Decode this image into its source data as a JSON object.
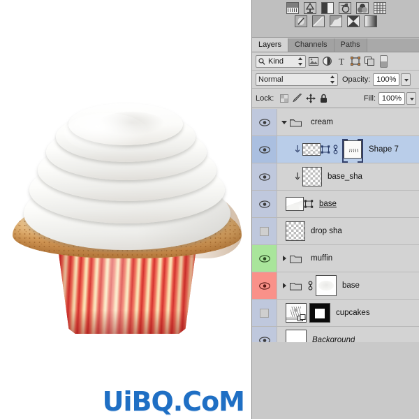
{
  "app": {
    "document_title": "cupcakes",
    "watermark": "UiBQ.CoM",
    "watermark_color": "#1f6fc4"
  },
  "canvas": {
    "name": "cupcake-illustration",
    "description": "Cupcake with white swirled cream frosting, golden baked muffin top and red striped paper liner",
    "background_color": "#ffffff",
    "colors": {
      "cream": "#ffffff",
      "cream_shadow": "#dedbd6",
      "muffin_light": "#f6dfb9",
      "muffin_dark": "#bd7f43",
      "liner_red": "#e8564a",
      "liner_deep_red": "#cf2f2c",
      "liner_cream": "#f9d7a6"
    }
  },
  "adjustments": {
    "name": "adjustments-panel",
    "row1": [
      {
        "icon": "brightness-contrast-icon",
        "label": "Brightness/Contrast"
      },
      {
        "icon": "levels-icon",
        "label": "Levels"
      },
      {
        "icon": "curves-icon",
        "label": "Curves"
      },
      {
        "icon": "exposure-icon",
        "label": "Exposure"
      },
      {
        "icon": "vibrance-icon",
        "label": "Vibrance"
      },
      {
        "icon": "hue-saturation-icon",
        "label": "Hue/Saturation"
      }
    ],
    "row2": [
      {
        "icon": "color-balance-icon",
        "label": "Color Balance"
      },
      {
        "icon": "black-white-icon",
        "label": "Black & White"
      },
      {
        "icon": "photo-filter-icon",
        "label": "Photo Filter"
      },
      {
        "icon": "channel-mixer-icon",
        "label": "Channel Mixer"
      },
      {
        "icon": "gradient-map-icon",
        "label": "Gradient Map"
      }
    ]
  },
  "panel": {
    "tabs": [
      {
        "label": "Layers",
        "active": true
      },
      {
        "label": "Channels",
        "active": false
      },
      {
        "label": "Paths",
        "active": false
      }
    ],
    "filter": {
      "kind_label": "Kind",
      "search_icon": "search-icon",
      "icons": [
        {
          "icon": "filter-pixel-icon",
          "label": "Filter for pixel layers"
        },
        {
          "icon": "filter-adjustment-icon",
          "label": "Filter for adjustment layers"
        },
        {
          "icon": "filter-type-icon",
          "label": "Filter for type layers"
        },
        {
          "icon": "filter-shape-icon",
          "label": "Filter for shape layers"
        },
        {
          "icon": "filter-smart-object-icon",
          "label": "Filter for smart objects"
        }
      ],
      "toggle_icon": "filter-toggle-switch"
    },
    "blend": {
      "mode": "Normal",
      "opacity_label": "Opacity:",
      "opacity_value": "100%",
      "fill_label": "Fill:",
      "fill_value": "100%"
    },
    "lock": {
      "label": "Lock:",
      "icons": [
        {
          "icon": "lock-transparency-icon",
          "label": "Lock transparent pixels"
        },
        {
          "icon": "lock-image-icon",
          "label": "Lock image pixels"
        },
        {
          "icon": "lock-position-icon",
          "label": "Lock position"
        },
        {
          "icon": "lock-all-icon",
          "label": "Lock all"
        }
      ]
    }
  },
  "layers": [
    {
      "name": "cream",
      "visible": true,
      "selected": false,
      "type": "group",
      "expanded": true,
      "indent": 0,
      "eye_tint": "none",
      "name_style": "plain"
    },
    {
      "name": "Shape 7",
      "visible": true,
      "selected": true,
      "type": "shape",
      "indent": 1,
      "eye_tint": "none",
      "linked": true,
      "has_vector_mask": true,
      "mask_selected": true,
      "name_style": "plain"
    },
    {
      "name": "base_sha",
      "visible": true,
      "selected": false,
      "type": "pixel",
      "indent": 1,
      "eye_tint": "none",
      "name_style": "plain"
    },
    {
      "name": "base",
      "visible": true,
      "selected": false,
      "type": "shape",
      "indent": 0,
      "eye_tint": "none",
      "has_vector_mask": true,
      "name_style": "underline"
    },
    {
      "name": "drop sha",
      "visible": false,
      "selected": false,
      "type": "pixel",
      "indent": 0,
      "eye_tint": "none",
      "name_style": "plain"
    },
    {
      "name": "muffin",
      "visible": true,
      "selected": false,
      "type": "group",
      "expanded": false,
      "indent": 0,
      "eye_tint": "#a9e59b",
      "name_style": "plain"
    },
    {
      "name": "base",
      "visible": true,
      "selected": false,
      "type": "group",
      "expanded": false,
      "indent": 0,
      "eye_tint": "#f99189",
      "linked": true,
      "name_style": "plain"
    },
    {
      "name": "cupcakes",
      "visible": false,
      "selected": false,
      "type": "smart-object",
      "indent": 0,
      "eye_tint": "none",
      "has_layer_mask": true,
      "name_style": "plain"
    },
    {
      "name": "Background",
      "visible": true,
      "selected": false,
      "type": "background",
      "indent": 0,
      "eye_tint": "none",
      "name_style": "italic"
    }
  ]
}
